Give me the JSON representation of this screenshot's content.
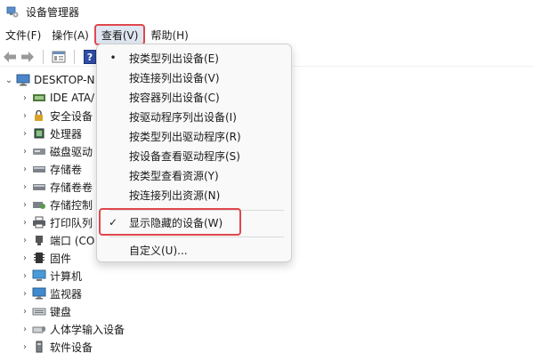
{
  "window": {
    "title": "设备管理器"
  },
  "menubar": [
    {
      "label": "文件(F)"
    },
    {
      "label": "操作(A)"
    },
    {
      "label": "查看(V)"
    },
    {
      "label": "帮助(H)"
    }
  ],
  "tree": {
    "root": "DESKTOP-N",
    "items": [
      {
        "label": "IDE ATA/",
        "icon": "ide-controller-icon"
      },
      {
        "label": "安全设备",
        "icon": "security-device-icon"
      },
      {
        "label": "处理器",
        "icon": "processor-icon"
      },
      {
        "label": "磁盘驱动",
        "icon": "disk-drive-icon"
      },
      {
        "label": "存储卷",
        "icon": "storage-volume-icon"
      },
      {
        "label": "存储卷卷",
        "icon": "storage-volume-icon"
      },
      {
        "label": "存储控制",
        "icon": "storage-controller-icon"
      },
      {
        "label": "打印队列",
        "icon": "printer-icon"
      },
      {
        "label": "端口 (CO",
        "icon": "port-icon"
      },
      {
        "label": "固件",
        "icon": "firmware-icon"
      },
      {
        "label": "计算机",
        "icon": "computer-icon"
      },
      {
        "label": "监视器",
        "icon": "monitor-icon"
      },
      {
        "label": "键盘",
        "icon": "keyboard-icon"
      },
      {
        "label": "人体学输入设备",
        "icon": "hid-icon"
      },
      {
        "label": "软件设备",
        "icon": "software-device-icon"
      }
    ]
  },
  "view_menu": {
    "items": [
      {
        "label": "按类型列出设备(E)",
        "mark": "•"
      },
      {
        "label": "按连接列出设备(V)",
        "mark": ""
      },
      {
        "label": "按容器列出设备(C)",
        "mark": ""
      },
      {
        "label": "按驱动程序列出设备(I)",
        "mark": ""
      },
      {
        "label": "按类型列出驱动程序(R)",
        "mark": ""
      },
      {
        "label": "按设备查看驱动程序(S)",
        "mark": ""
      },
      {
        "label": "按类型查看资源(Y)",
        "mark": ""
      },
      {
        "label": "按连接列出资源(N)",
        "mark": ""
      },
      {
        "label": "显示隐藏的设备(W)",
        "mark": "✓"
      },
      {
        "label": "自定义(U)...",
        "mark": ""
      }
    ]
  },
  "colors": {
    "highlight": "#e0474c",
    "active_menu_bg": "#dfe7f2"
  }
}
